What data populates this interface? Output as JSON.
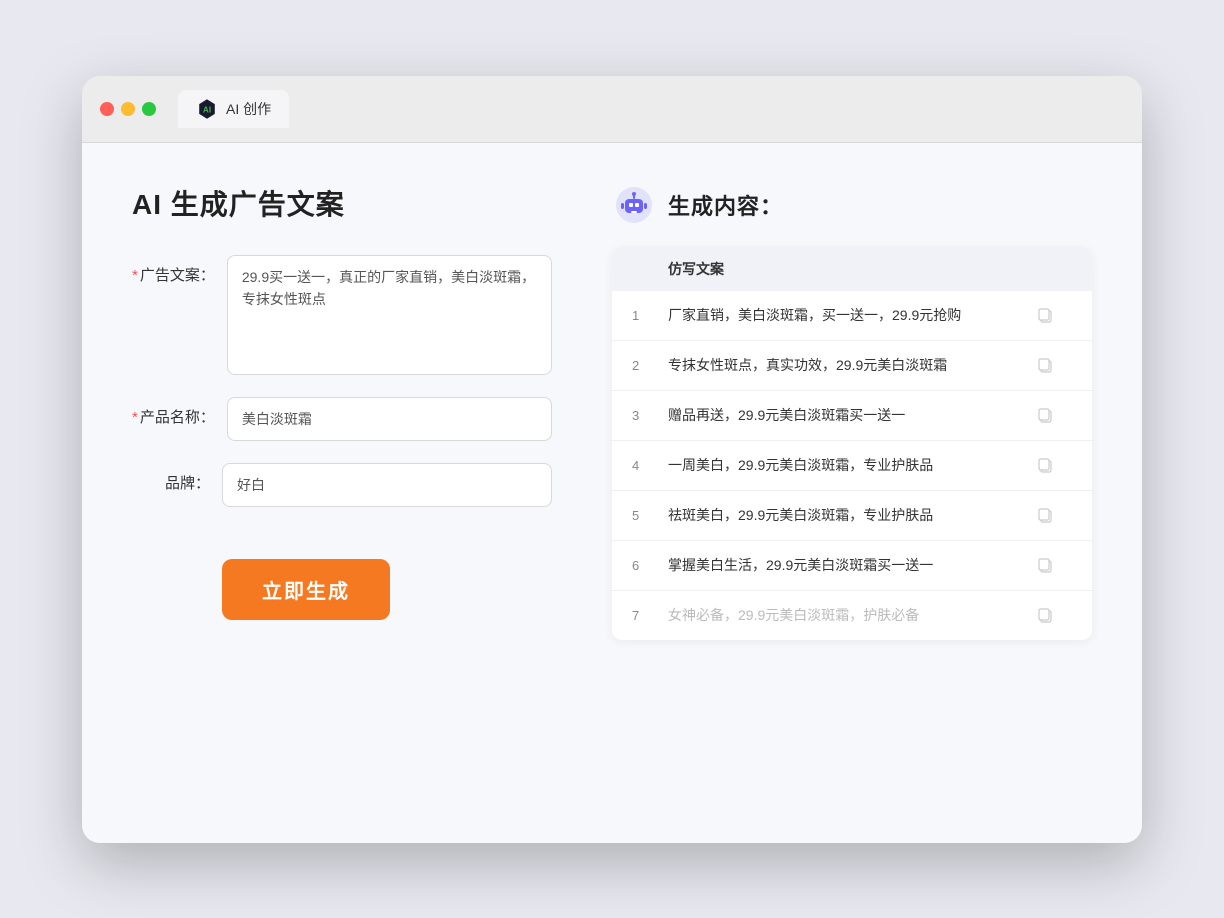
{
  "browser": {
    "tab_label": "AI 创作",
    "traffic_lights": [
      "red",
      "yellow",
      "green"
    ]
  },
  "left_panel": {
    "title": "AI 生成广告文案",
    "form": {
      "ad_copy_label": "广告文案：",
      "ad_copy_required": "*",
      "ad_copy_value": "29.9买一送一，真正的厂家直销，美白淡斑霜，专抹女性斑点",
      "product_name_label": "产品名称：",
      "product_name_required": "*",
      "product_name_value": "美白淡斑霜",
      "brand_label": "品牌：",
      "brand_value": "好白"
    },
    "generate_button": "立即生成"
  },
  "right_panel": {
    "title": "生成内容：",
    "table_header": "仿写文案",
    "results": [
      {
        "num": "1",
        "text": "厂家直销，美白淡斑霜，买一送一，29.9元抢购",
        "muted": false
      },
      {
        "num": "2",
        "text": "专抹女性斑点，真实功效，29.9元美白淡斑霜",
        "muted": false
      },
      {
        "num": "3",
        "text": "赠品再送，29.9元美白淡斑霜买一送一",
        "muted": false
      },
      {
        "num": "4",
        "text": "一周美白，29.9元美白淡斑霜，专业护肤品",
        "muted": false
      },
      {
        "num": "5",
        "text": "祛斑美白，29.9元美白淡斑霜，专业护肤品",
        "muted": false
      },
      {
        "num": "6",
        "text": "掌握美白生活，29.9元美白淡斑霜买一送一",
        "muted": false
      },
      {
        "num": "7",
        "text": "女神必备，29.9元美白淡斑霜，护肤必备",
        "muted": true
      }
    ]
  },
  "colors": {
    "accent": "#f47920",
    "required": "#ff4d4f"
  }
}
